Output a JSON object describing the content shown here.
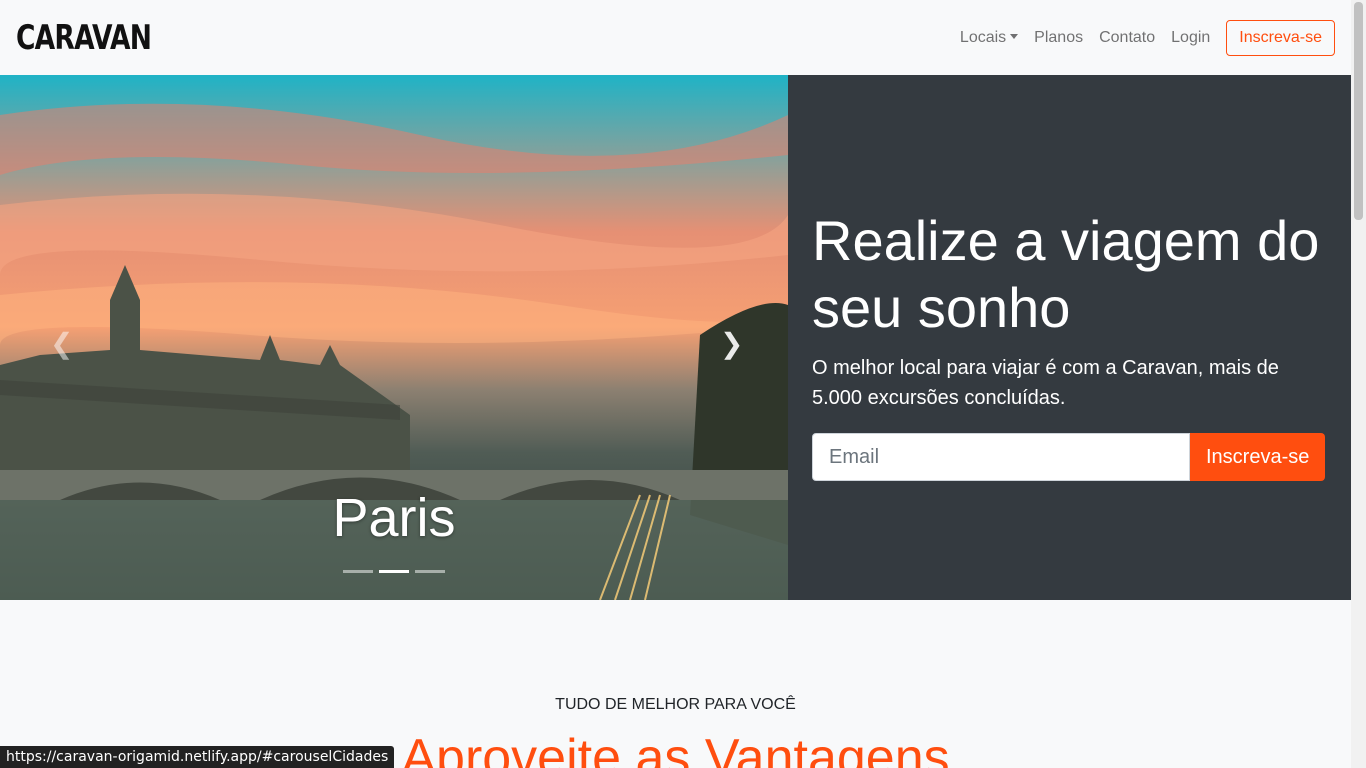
{
  "navbar": {
    "brand": "CARAVAN",
    "links": [
      "Locais",
      "Planos",
      "Contato",
      "Login"
    ],
    "cta": "Inscreva-se"
  },
  "carousel": {
    "caption": "Paris",
    "prev_icon": "chevron-left-icon",
    "next_icon": "chevron-right-icon",
    "active_index": 1,
    "slide_count": 3
  },
  "hero": {
    "title": "Realize a viagem do seu sonho",
    "text": "O melhor local para viajar é com a Caravan, mais de 5.000 excursões concluídas.",
    "email_placeholder": "Email",
    "button": "Inscreva-se"
  },
  "section": {
    "subtitle": "TUDO DE MELHOR PARA VOCÊ",
    "title": "Aproveite as Vantagens"
  },
  "statusbar": {
    "url": "https://caravan-origamid.netlify.app/#carouselCidades"
  },
  "colors": {
    "accent": "#ff4e0f",
    "hero_bg": "#343a40",
    "page_bg": "#f8f9fa"
  }
}
